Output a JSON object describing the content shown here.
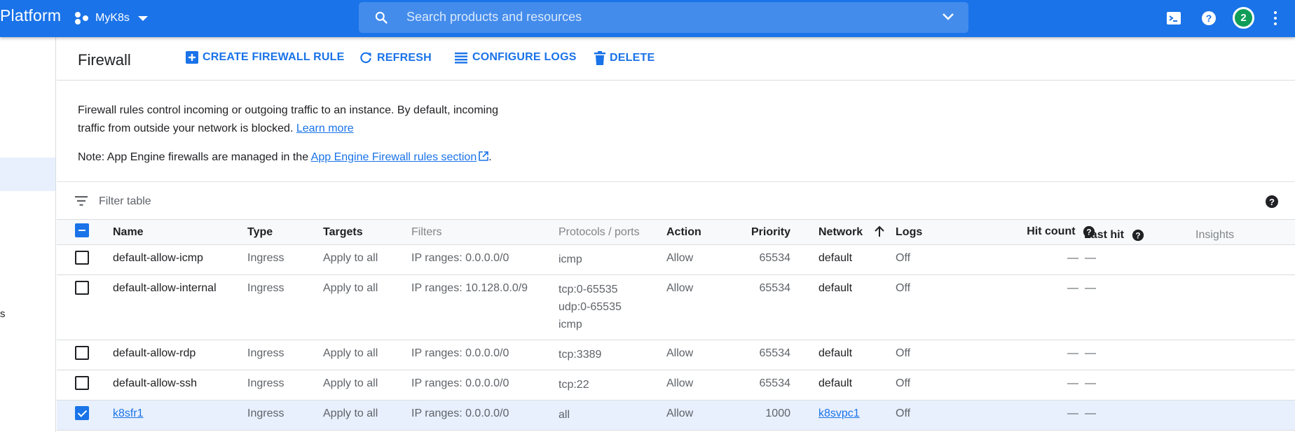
{
  "topbar": {
    "brand": "Platform",
    "project": "MyK8s",
    "search_placeholder": "Search products and resources",
    "avatar_initial": "2"
  },
  "leftnav": {
    "fragment": "s"
  },
  "header": {
    "title": "Firewall",
    "actions": {
      "create": "CREATE FIREWALL RULE",
      "refresh": "REFRESH",
      "configure_logs": "CONFIGURE LOGS",
      "delete": "DELETE"
    }
  },
  "info": {
    "line1": "Firewall rules control incoming or outgoing traffic to an instance. By default, incoming",
    "line2": "traffic from outside your network is blocked.",
    "learn_more": "Learn more",
    "note_prefix": "Note: App Engine firewalls are managed in the",
    "note_link": "App Engine Firewall rules section",
    "note_suffix": "."
  },
  "filter": {
    "placeholder": "Filter table"
  },
  "table": {
    "headers": {
      "name": "Name",
      "type": "Type",
      "targets": "Targets",
      "filters": "Filters",
      "protocols": "Protocols / ports",
      "action": "Action",
      "priority": "Priority",
      "network": "Network",
      "logs": "Logs",
      "hit_count": "Hit count",
      "last_hit": "Last hit",
      "insights": "Insights"
    },
    "rows": [
      {
        "name": "default-allow-icmp",
        "type": "Ingress",
        "targets": "Apply to all",
        "filters": "IP ranges: 0.0.0.0/0",
        "protocols": [
          "icmp"
        ],
        "action": "Allow",
        "priority": "65534",
        "network": "default",
        "logs": "Off",
        "hit_count": "—",
        "last_hit": "—",
        "checked": false
      },
      {
        "name": "default-allow-internal",
        "type": "Ingress",
        "targets": "Apply to all",
        "filters": "IP ranges: 10.128.0.0/9",
        "protocols": [
          "tcp:0-65535",
          "udp:0-65535",
          "icmp"
        ],
        "action": "Allow",
        "priority": "65534",
        "network": "default",
        "logs": "Off",
        "hit_count": "—",
        "last_hit": "—",
        "checked": false
      },
      {
        "name": "default-allow-rdp",
        "type": "Ingress",
        "targets": "Apply to all",
        "filters": "IP ranges: 0.0.0.0/0",
        "protocols": [
          "tcp:3389"
        ],
        "action": "Allow",
        "priority": "65534",
        "network": "default",
        "logs": "Off",
        "hit_count": "—",
        "last_hit": "—",
        "checked": false
      },
      {
        "name": "default-allow-ssh",
        "type": "Ingress",
        "targets": "Apply to all",
        "filters": "IP ranges: 0.0.0.0/0",
        "protocols": [
          "tcp:22"
        ],
        "action": "Allow",
        "priority": "65534",
        "network": "default",
        "logs": "Off",
        "hit_count": "—",
        "last_hit": "—",
        "checked": false
      },
      {
        "name": "k8sfr1",
        "type": "Ingress",
        "targets": "Apply to all",
        "filters": "IP ranges: 0.0.0.0/0",
        "protocols": [
          "all"
        ],
        "action": "Allow",
        "priority": "1000",
        "network": "k8svpc1",
        "logs": "Off",
        "hit_count": "—",
        "last_hit": "—",
        "checked": true
      }
    ]
  },
  "colors": {
    "topbar": "#1a73e8",
    "link": "#1a73e8",
    "selected_row": "#e8f0fe",
    "avatar": "#0f9d58"
  }
}
